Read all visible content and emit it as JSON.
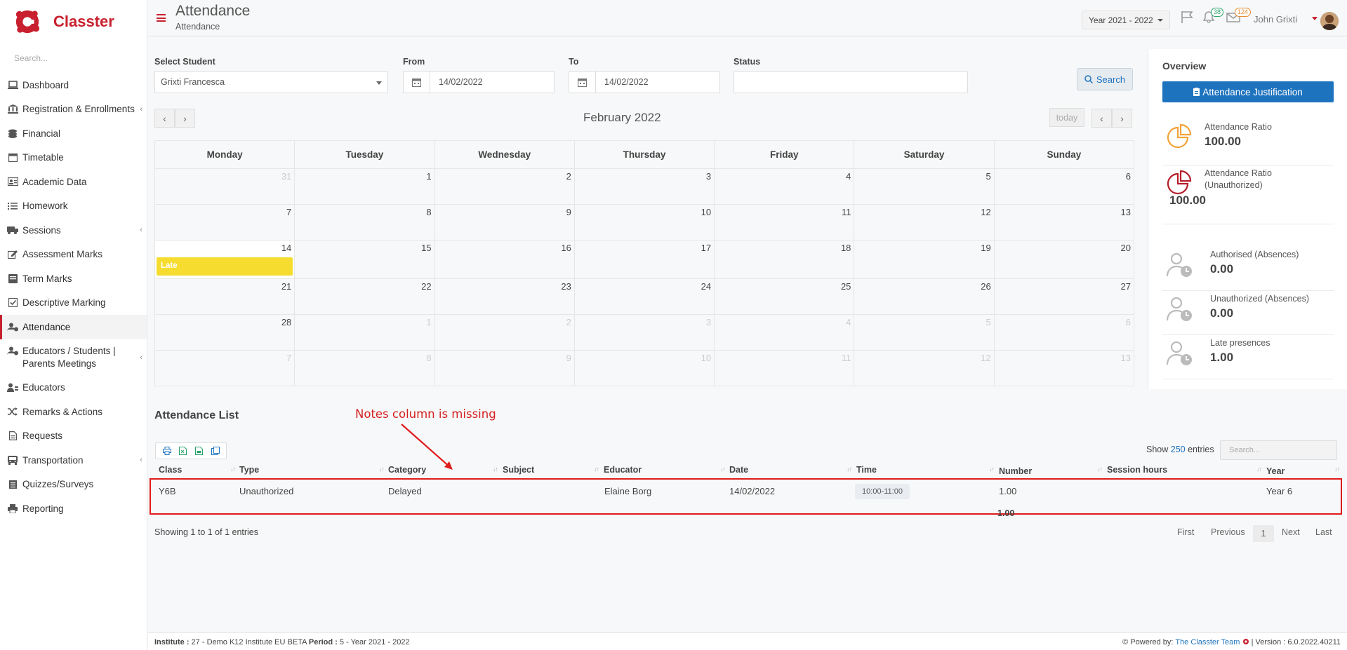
{
  "app": {
    "brand": "Classter"
  },
  "sidebar": {
    "search_placeholder": "Search...",
    "items": [
      {
        "label": "Dashboard",
        "icon": "laptop-icon"
      },
      {
        "label": "Registration & Enrollments",
        "icon": "institution-icon"
      },
      {
        "label": "Financial",
        "icon": "coins-icon"
      },
      {
        "label": "Timetable",
        "icon": "calendar-icon"
      },
      {
        "label": "Academic Data",
        "icon": "id-card-icon"
      },
      {
        "label": "Homework",
        "icon": "list-icon"
      },
      {
        "label": "Sessions",
        "icon": "bus-icon"
      },
      {
        "label": "Assessment Marks",
        "icon": "edit-icon"
      },
      {
        "label": "Term Marks",
        "icon": "book-icon"
      },
      {
        "label": "Descriptive Marking",
        "icon": "check-square-icon"
      },
      {
        "label": "Attendance",
        "icon": "user-clock-icon"
      },
      {
        "label": "Educators / Students | Parents Meetings",
        "icon": "users-clock-icon"
      },
      {
        "label": "Educators",
        "icon": "user-tie-icon"
      },
      {
        "label": "Remarks & Actions",
        "icon": "random-icon"
      },
      {
        "label": "Requests",
        "icon": "file-icon"
      },
      {
        "label": "Transportation",
        "icon": "bus-front-icon"
      },
      {
        "label": "Quizzes/Surveys",
        "icon": "clipboard-icon"
      },
      {
        "label": "Reporting",
        "icon": "printer-icon"
      }
    ]
  },
  "header": {
    "title": "Attendance",
    "subtitle": "Attendance",
    "year": "Year 2021 - 2022",
    "notifications_count": "38",
    "messages_count": "124",
    "user_name": "John Grixti"
  },
  "filters": {
    "student_label": "Select Student",
    "student_value": "Grixti Francesca",
    "from_label": "From",
    "from_value": "14/02/2022",
    "to_label": "To",
    "to_value": "14/02/2022",
    "status_label": "Status",
    "status_value": "",
    "search_button": "Search"
  },
  "calendar": {
    "title": "February 2022",
    "today_label": "today",
    "weekdays": [
      "Monday",
      "Tuesday",
      "Wednesday",
      "Thursday",
      "Friday",
      "Saturday",
      "Sunday"
    ],
    "weeks": [
      [
        "31",
        "1",
        "2",
        "3",
        "4",
        "5",
        "6"
      ],
      [
        "7",
        "8",
        "9",
        "10",
        "11",
        "12",
        "13"
      ],
      [
        "14",
        "15",
        "16",
        "17",
        "18",
        "19",
        "20"
      ],
      [
        "21",
        "22",
        "23",
        "24",
        "25",
        "26",
        "27"
      ],
      [
        "28",
        "1",
        "2",
        "3",
        "4",
        "5",
        "6"
      ],
      [
        "7",
        "8",
        "9",
        "10",
        "11",
        "12",
        "13"
      ]
    ],
    "event_label": "Late",
    "event_color": "#f5dc2f"
  },
  "overview": {
    "title": "Overview",
    "button": "Attendance Justification",
    "stats": [
      {
        "label": "Attendance Ratio",
        "value": "100.00"
      },
      {
        "label": "Attendance Ratio (Unauthorized)",
        "value": "100.00"
      },
      {
        "label": "Authorised (Absences)",
        "value": "0.00"
      },
      {
        "label": "Unauthorized (Absences)",
        "value": "0.00"
      },
      {
        "label": "Late presences",
        "value": "1.00"
      }
    ]
  },
  "attendance_list": {
    "title": "Attendance List",
    "annotation": "Notes column is missing",
    "show_label": "Show",
    "show_count": "250",
    "entries_label": "entries",
    "search_placeholder": "Search...",
    "columns": [
      "Class",
      "Type",
      "Category",
      "Subject",
      "Educator",
      "Date",
      "Time",
      "Number",
      "Session hours",
      "Year"
    ],
    "row": {
      "class": "Y6B",
      "type": "Unauthorized",
      "category": "Delayed",
      "subject": "",
      "educator": "Elaine Borg",
      "date": "14/02/2022",
      "time": "10:00-11:00",
      "number": "1.00",
      "session_hours": "",
      "year": "Year 6"
    },
    "total_number": "1.00",
    "info": "Showing 1 to 1 of 1 entries",
    "pager": {
      "first": "First",
      "previous": "Previous",
      "current": "1",
      "next": "Next",
      "last": "Last"
    }
  },
  "footer": {
    "institute_label": "Institute :",
    "institute_value": "27 - Demo K12 Institute EU BETA",
    "period_label": "Period :",
    "period_value": "5 - Year 2021 - 2022",
    "powered_label": "Powered by:",
    "powered_link": "The Classter Team",
    "version": "| Version : 6.0.2022.40211"
  },
  "colors": {
    "brand": "#c8202e",
    "primary": "#1e73be",
    "late": "#f5dc2f",
    "annotation": "#e01b1b"
  }
}
